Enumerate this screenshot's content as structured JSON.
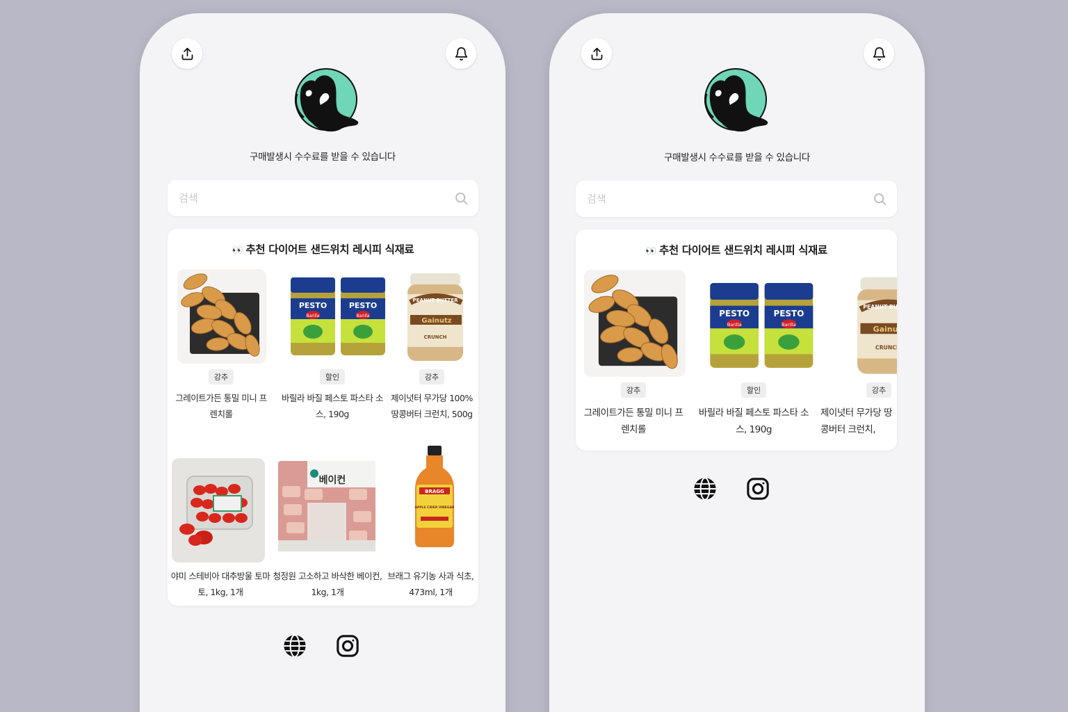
{
  "notice": "구매발생시 수수료를 받을 수 있습니다",
  "search": {
    "placeholder": "검색"
  },
  "section": {
    "emoji": "👀",
    "title": "추천 다이어트 샌드위치 레시피 식재료"
  },
  "products": [
    {
      "name": "그레이트가든 통밀 미니 프렌치롤",
      "badge": "강추"
    },
    {
      "name": "바릴라 바질 페스토 파스타 소스, 190g",
      "badge": "할인"
    },
    {
      "name": "제이넛터 무가당 100% 땅콩버터 크런치, 500g",
      "badge": "강추"
    },
    {
      "name": "야미 스테비아 대추방울 토마토, 1kg, 1개",
      "badge": ""
    },
    {
      "name": "청정원 고소하고 바삭한 베이컨, 1kg, 1개",
      "badge": ""
    },
    {
      "name": "브래그 유기농 사과 식초, 473ml, 1개",
      "badge": ""
    }
  ],
  "right_products": [
    {
      "name": "그레이트가든 통밀 미니 프렌치롤",
      "badge": "강추"
    },
    {
      "name": "바릴라 바질 페스토 파스타 소스, 190g",
      "badge": "할인"
    },
    {
      "name": "제이넛터 무가당 땅콩버터 크런치,",
      "badge": "강추"
    }
  ],
  "product_labels": {
    "pesto": "PESTO",
    "barilla": "Barilla",
    "peanut": "PEANUT BUTTER",
    "gainut": "Gainutz",
    "crunch": "CRUNCH",
    "bacon": "베이컨",
    "bragg": "BRAGG",
    "vinegar": "APPLE CIDER VINEGAR"
  },
  "icons": [
    "share-icon",
    "bell-icon",
    "search-icon",
    "globe-icon",
    "instagram-icon"
  ],
  "colors": {
    "background": "#b9b8c6",
    "phone": "#f4f4f6",
    "avatar_accent": "#6fd6b8"
  }
}
